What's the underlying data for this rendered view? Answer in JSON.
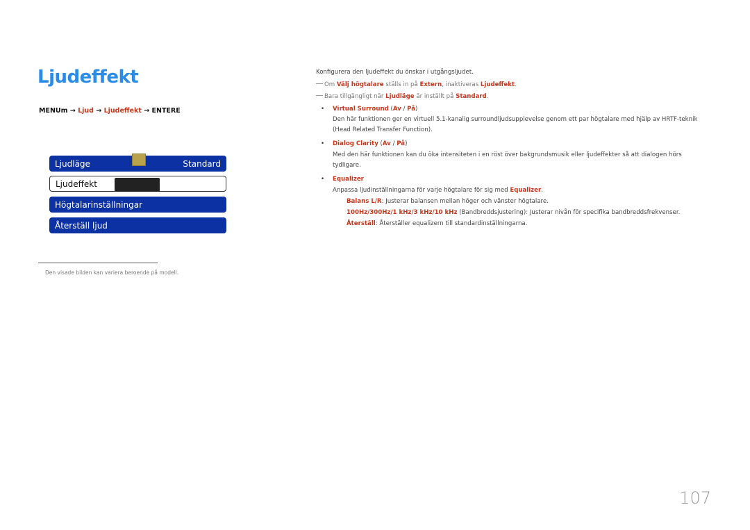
{
  "title": "Ljudeffekt",
  "menu_path": {
    "menu": "MENUm",
    "arrow1": "→",
    "ljud": "Ljud",
    "arrow2": "→",
    "ljudeffekt": "Ljudeffekt",
    "arrow3": "→",
    "entere": "ENTERE"
  },
  "osd_menu": {
    "items": [
      {
        "label": "Ljudläge",
        "value": "Standard"
      },
      {
        "label": "Ljudeffekt"
      },
      {
        "label": "Högtalarinställningar"
      },
      {
        "label": "Återställ ljud"
      }
    ],
    "colors": {
      "item_bg": "#0c31a3",
      "knob": "#b8a24c"
    }
  },
  "footnote": "Den visade bilden kan variera beroende på modell.",
  "content": {
    "intro": "Konfigurera den ljudeffekt du önskar i utgångsljudet.",
    "note1": {
      "pre": "Om ",
      "b1": "Välj högtalare",
      "mid1": " ställs in på ",
      "b2": "Extern",
      "mid2": ", inaktiveras ",
      "b3": "Ljudeffekt",
      "post": "."
    },
    "note2": {
      "pre": "Bara tillgängligt när ",
      "b1": "Ljudläge",
      "mid1": " är inställt på ",
      "b2": "Standard",
      "post": "."
    },
    "virtual_surround": {
      "title": "Virtual Surround",
      "open": " (",
      "off": "Av",
      "sep": " / ",
      "on": "På",
      "close": ")",
      "desc": "Den här funktionen ger en virtuell 5.1-kanalig surroundljudsupplevelse genom ett par högtalare med hjälp av HRTF-teknik (Head Related Transfer Function)."
    },
    "dialog_clarity": {
      "title": "Dialog Clarity",
      "open": " (",
      "off": "Av",
      "sep": " / ",
      "on": "På",
      "close": ")",
      "desc": "Med den här funktionen kan du öka intensiteten i en röst över bakgrundsmusik eller ljudeffekter så att dialogen hörs tydligare."
    },
    "equalizer": {
      "title": "Equalizer",
      "desc_pre": "Anpassa ljudinställningarna för varje högtalare för sig med ",
      "desc_b": "Equalizer",
      "desc_post": ".",
      "balance": {
        "b": "Balans L/R",
        "text": ": Justerar balansen mellan höger och vänster högtalare."
      },
      "bands": {
        "b": "100Hz/300Hz/1 kHz/3 kHz/10 kHz",
        "text": " (Bandbreddsjustering): Justerar nivån för specifika bandbreddsfrekvenser."
      },
      "reset": {
        "b": "Återställ",
        "text": ": Återställer equalizern till standardinställningarna."
      }
    }
  },
  "page_number": "107"
}
